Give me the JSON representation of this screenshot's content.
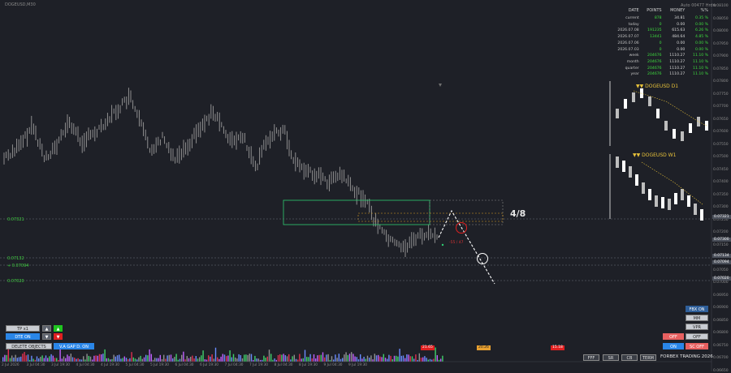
{
  "header": {
    "symbol": "DOGEUSD,M30",
    "right_info": "Auto 00477 Hrdw"
  },
  "yaxis": {
    "ticks": [
      "0.08100",
      "0.08050",
      "0.08000",
      "0.07950",
      "0.07900",
      "0.07850",
      "0.07800",
      "0.07750",
      "0.07700",
      "0.07650",
      "0.07600",
      "0.07550",
      "0.07500",
      "0.07450",
      "0.07400",
      "0.07350",
      "0.07300",
      "0.07250",
      "0.07200",
      "0.07150",
      "0.07100",
      "0.07050",
      "0.07000",
      "0.06950",
      "0.06900",
      "0.06850",
      "0.06800",
      "0.06750",
      "0.06700",
      "0.06650"
    ],
    "price_boxes": [
      "0.07321",
      "0.07300",
      "0.07134",
      "0.07094",
      "0.07020"
    ]
  },
  "levels": {
    "upper": "0.07321",
    "mid1": "0.07132",
    "mid2": "0.07094",
    "lower": "0.07020"
  },
  "stats": {
    "headers": [
      "DATE",
      "POINTS",
      "MONEY",
      "%%"
    ],
    "rows": [
      {
        "date": "current",
        "points": "878",
        "money": "34.81",
        "pct": "0.35 %"
      },
      {
        "date": "today",
        "points": "0",
        "money": "0.00",
        "pct": "0.00 %"
      },
      {
        "date": "2026.07.08",
        "points": "191235",
        "money": "615.63",
        "pct": "6.26 %"
      },
      {
        "date": "2026.07.07",
        "points": "13441",
        "money": "484.64",
        "pct": "4.85 %"
      },
      {
        "date": "2026.07.06",
        "points": "0",
        "money": "0.00",
        "pct": "0.00 %"
      },
      {
        "date": "2026.07.03",
        "points": "0",
        "money": "0.00",
        "pct": "0.00 %"
      },
      {
        "date": "week",
        "points": "204676",
        "money": "1110.27",
        "pct": "11.10 %"
      },
      {
        "date": "month",
        "points": "204676",
        "money": "1110.27",
        "pct": "11.10 %"
      },
      {
        "date": "quarter",
        "points": "204676",
        "money": "1110.27",
        "pct": "11.10 %"
      },
      {
        "date": "year",
        "points": "204676",
        "money": "1110.27",
        "pct": "11.10 %"
      }
    ]
  },
  "mini_charts": {
    "d1_title": "DOGEUSD D1",
    "w1_title": "DOGEUSD W1"
  },
  "annotations": {
    "fraction": "4/8",
    "tp_label": "-55 / 47"
  },
  "left_panel": {
    "tp": "TP x1",
    "dte": "DTE ON",
    "delete": "DELETE OBJECTS",
    "gap": "V.A GAP D. ON",
    "up_arrow": "▲",
    "down_arrow": "▼"
  },
  "right_panel": {
    "fbx": "FBX ON",
    "mm": "MM",
    "vpr": "VPR",
    "off1": "OFF",
    "off2": "OFF",
    "on": "ON",
    "sc": "SC OFF"
  },
  "bottom_buttons": {
    "fff": "FFF",
    "sr": "SR",
    "cb": "CB",
    "term": "TERM"
  },
  "brand": "FORBEX TRADING 2026",
  "volume_labels": {
    "v1": "21.65",
    "v2": "20.26",
    "v3": "15.18"
  },
  "xaxis": {
    "ticks": [
      "2 Jul 2026",
      "3 Jul 04:30",
      "3 Jul 19:30",
      "4 Jul 04:30",
      "4 Jul 19:30",
      "5 Jul 04:30",
      "5 Jul 19:30",
      "6 Jul 04:30",
      "6 Jul 19:30",
      "7 Jul 04:30",
      "7 Jul 19:30",
      "8 Jul 04:30",
      "8 Jul 19:30",
      "9 Jul 04:30",
      "9 Jul 19:30"
    ]
  },
  "colors": {
    "background": "#1e2027",
    "candle": "#9a9a9a",
    "zone_green": "#2ecc71",
    "zone_orange": "#e0a020",
    "level_green": "#3ecf3e",
    "tp_circle": "#e02020"
  }
}
